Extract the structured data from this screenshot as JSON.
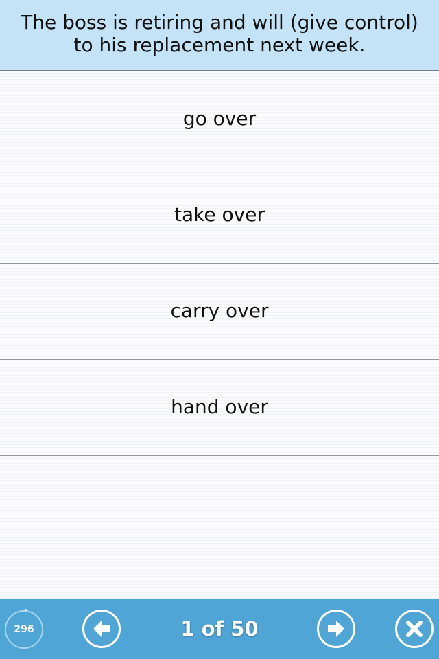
{
  "question": {
    "text": "The boss is retiring and will (give control) to his replacement next week."
  },
  "options": [
    {
      "label": "go over"
    },
    {
      "label": "take over"
    },
    {
      "label": "carry over"
    },
    {
      "label": "hand over"
    }
  ],
  "footer": {
    "score": "296",
    "page_indicator": "1 of 50",
    "prev_icon": "arrow-left-icon",
    "next_icon": "arrow-right-icon",
    "close_icon": "close-icon"
  },
  "colors": {
    "header_background": "#c5e3f6",
    "footer_background": "#4fa5d6",
    "divider": "#8d97a3"
  }
}
